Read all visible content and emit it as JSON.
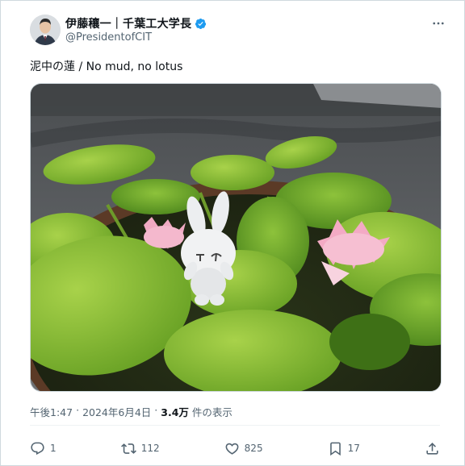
{
  "author": {
    "name": "伊藤穰一｜千葉工大学長",
    "handle": "@PresidentofCIT"
  },
  "tweet": {
    "text": "泥中の蓮 / No mud, no lotus"
  },
  "meta": {
    "time": "午後1:47",
    "separator1": "·",
    "date": "2024年6月4日",
    "separator2": "·",
    "views_count": "3.4万",
    "views_label": "件の表示"
  },
  "actions": {
    "reply_count": "1",
    "retweet_count": "112",
    "like_count": "825",
    "bookmark_count": "17"
  },
  "icons": {
    "verified": "verified-badge-icon",
    "more": "more-icon",
    "reply": "reply-icon",
    "retweet": "retweet-icon",
    "like": "heart-icon",
    "bookmark": "bookmark-icon",
    "share": "share-icon"
  },
  "colors": {
    "verified_blue": "#1d9bf0",
    "secondary_text": "#536471",
    "primary_text": "#0f1419"
  }
}
